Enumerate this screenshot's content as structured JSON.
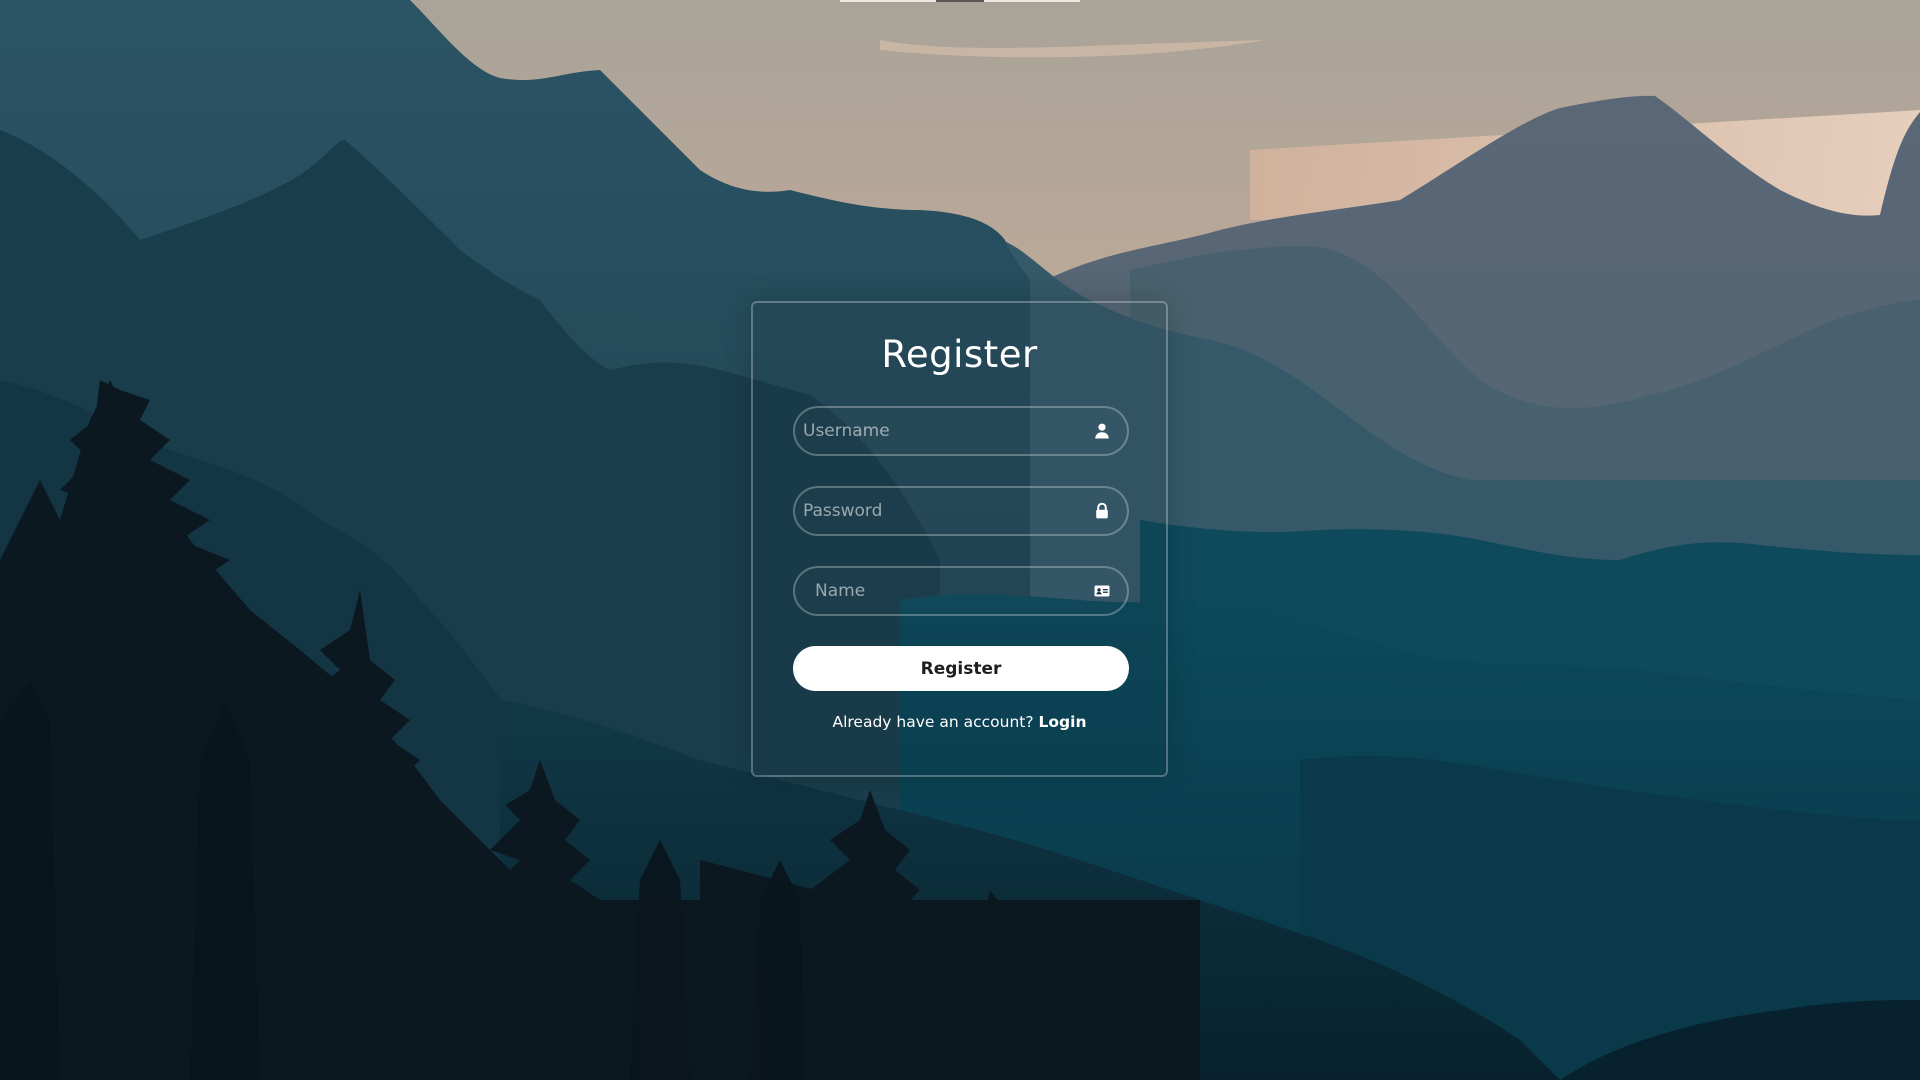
{
  "form": {
    "title": "Register",
    "username": {
      "placeholder": "Username",
      "icon": "user-icon"
    },
    "password": {
      "placeholder": "Password",
      "icon": "lock-icon"
    },
    "name": {
      "placeholder": "Name",
      "icon": "id-card-icon"
    },
    "submit_label": "Register",
    "prompt_text": "Already have an account?",
    "login_link": "Login"
  },
  "colors": {
    "sky_top": "#a8a398",
    "sky_glow": "#e8c7ab",
    "far_mountain": "#566573",
    "mid_mountain": "#2e5262",
    "deep_teal": "#0b4152",
    "forest": "#0b1820",
    "card_border": "#ffffff",
    "button_bg": "#ffffff",
    "button_text": "#1e1e1e"
  }
}
